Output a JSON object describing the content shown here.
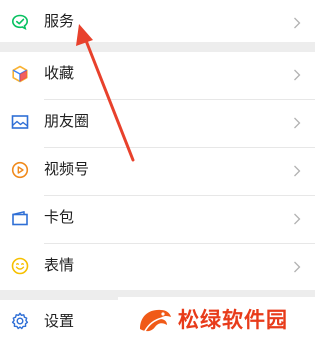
{
  "menu": {
    "items": [
      {
        "label": "服务",
        "icon": "services-icon"
      },
      {
        "label": "收藏",
        "icon": "favorites-icon"
      },
      {
        "label": "朋友圈",
        "icon": "moments-icon"
      },
      {
        "label": "视频号",
        "icon": "channels-icon"
      },
      {
        "label": "卡包",
        "icon": "cards-icon"
      },
      {
        "label": "表情",
        "icon": "stickers-icon"
      },
      {
        "label": "设置",
        "icon": "settings-icon"
      }
    ]
  },
  "annotation": {
    "type": "arrow",
    "color": "#e8412c"
  },
  "watermark": {
    "text": "松绿软件园",
    "color": "#e83b1a"
  },
  "colors": {
    "services_icon": "#07c160",
    "favorites_icon": "#f9b233",
    "moments_icon": "#2f6fd6",
    "channels_icon": "#f08a1c",
    "cards_icon": "#2f6fd6",
    "stickers_icon": "#f6c000",
    "settings_icon": "#2f6fd6",
    "gap": "#ededed"
  }
}
